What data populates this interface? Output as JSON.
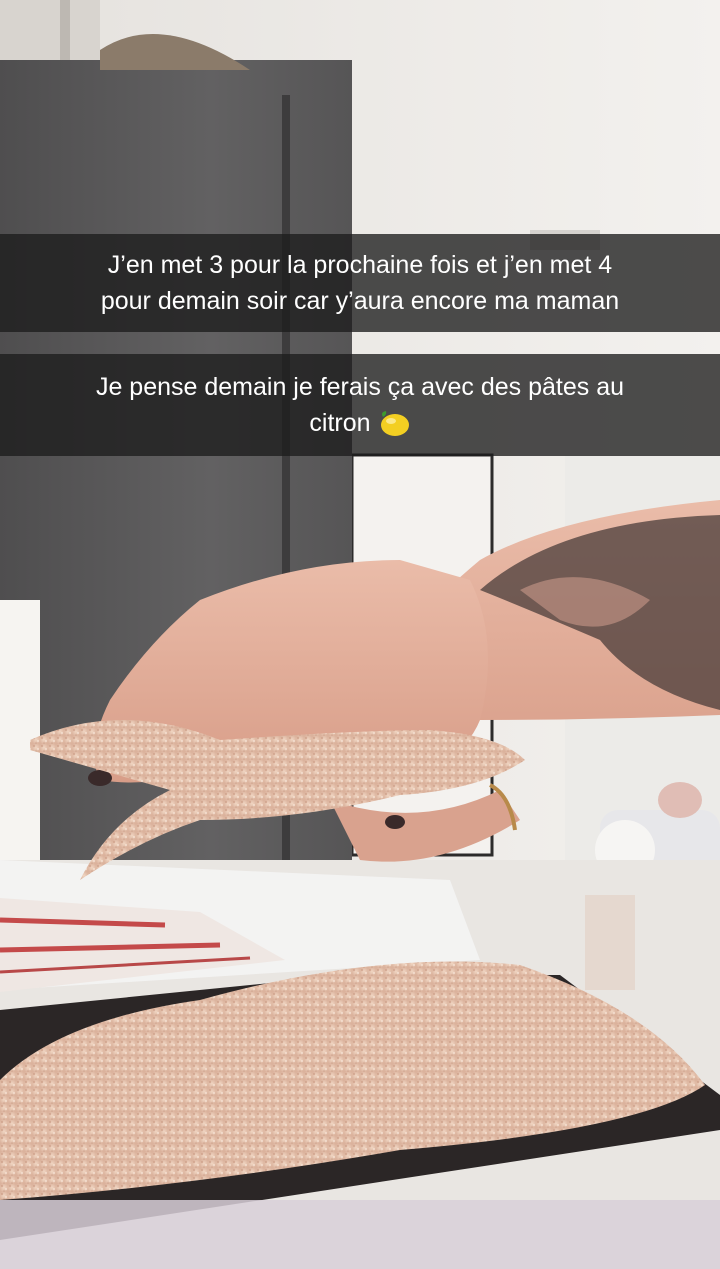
{
  "captions": [
    {
      "line1": "J’en met 3 pour la prochaine fois et j’en met 4",
      "line2": "pour demain soir car y’aura encore ma maman"
    },
    {
      "line1": "Je pense demain je ferais ça avec des pâtes au",
      "line2": "citron",
      "emoji": "lemon-icon"
    }
  ],
  "colors": {
    "caption_bg": "#1c1c1c",
    "caption_text": "#ffffff",
    "fridge": "#5b5a5a",
    "wall": "#eeebe7",
    "skin": "#e6b5a3",
    "breading": "#e8cbb6",
    "tray": "#2b2626",
    "lemon": "#f3cf22"
  }
}
